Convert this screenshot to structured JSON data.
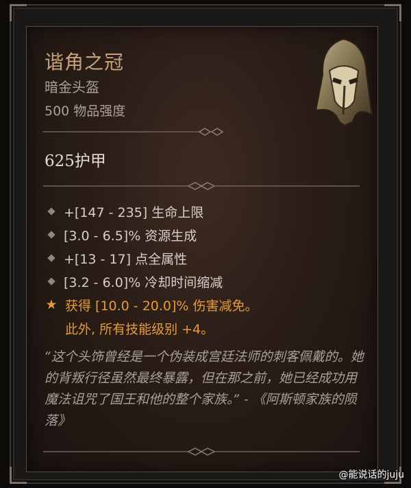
{
  "item": {
    "name": "谐角之冠",
    "type": "暗金头盔",
    "power": "500 物品强度",
    "armor": "625护甲",
    "affixes": [
      "+[147 - 235] 生命上限",
      "[3.0 - 6.5]% 资源生成",
      "+[13 - 17] 点全属性",
      "[3.2 - 6.0]% 冷却时间缩减"
    ],
    "legendary_line1": "获得 [10.0 - 20.0]% 伤害减免。",
    "legendary_line2": "此外, 所有技能级别 +4。",
    "flavor_text": "“这个头饰曾经是一个伪装成宫廷法师的刺客佩戴的。她的背叛行径虽然最终暴露，但在那之前，她已经成功用魔法诅咒了国王和他的整个家族。” - 《阿斯顿家族的陨落》"
  },
  "watermark": "@能说话的juju",
  "colors": {
    "title": "#c9a27a",
    "legendary": "#e69a3a",
    "text": "#d8d0c8",
    "muted": "#a9a19a"
  }
}
